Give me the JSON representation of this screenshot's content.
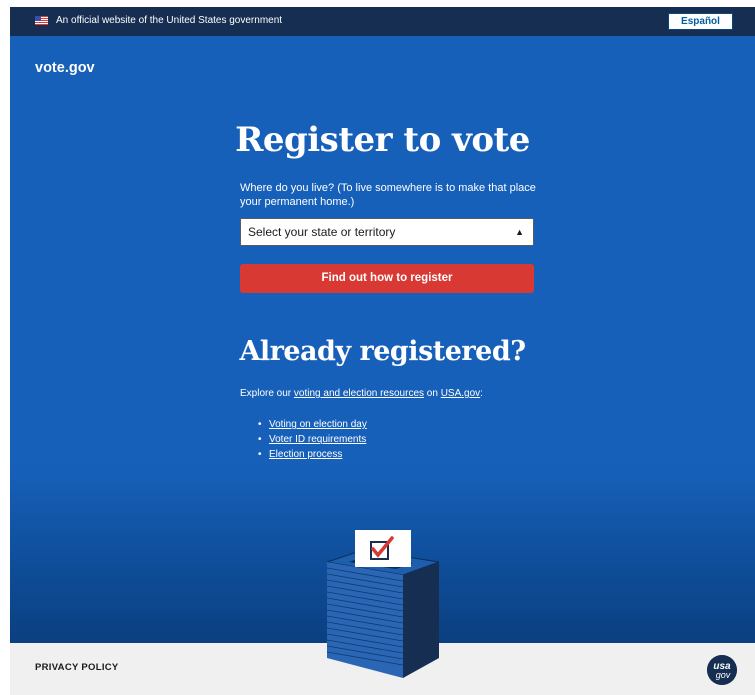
{
  "banner": {
    "official_text": "An official website of the United States government",
    "language_button": "Español"
  },
  "site": {
    "logo": "vote.gov"
  },
  "register": {
    "heading": "Register to vote",
    "question": "Where do you live? (To live somewhere is to make that place your permanent home.)",
    "select_value": "Select your state or territory",
    "button": "Find out how to register"
  },
  "registered": {
    "heading": "Already registered?",
    "explore_prefix": "Explore our ",
    "explore_link": "voting and election resources",
    "explore_mid": " on ",
    "explore_site": "USA.gov",
    "explore_suffix": ":",
    "links": [
      "Voting on election day",
      "Voter ID requirements",
      "Election process"
    ]
  },
  "footer": {
    "privacy": "PRIVACY POLICY",
    "logo_top": "usa",
    "logo_bottom": "gov"
  },
  "icons": {
    "flag": "us-flag-icon",
    "select": "up-down-arrows-icon",
    "ballot": "ballot-box-icon",
    "check": "checkmark-icon"
  },
  "colors": {
    "banner_bg": "#162e51",
    "hero_bg": "#1760ba",
    "button_red": "#d83933",
    "footer_bg": "#f0f0f0",
    "ballot_dark": "#162e51"
  }
}
